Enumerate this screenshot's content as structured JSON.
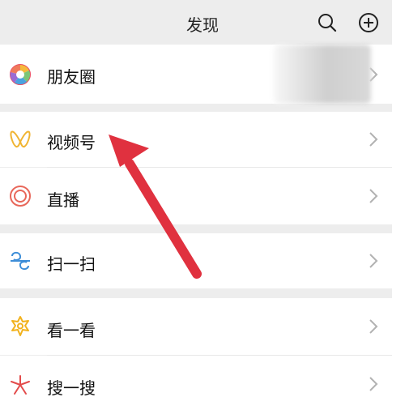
{
  "header": {
    "title": "发现"
  },
  "menu": {
    "moments": "朋友圈",
    "channels": "视频号",
    "live": "直播",
    "scan": "扫一扫",
    "top_stories": "看一看",
    "search": "搜一搜"
  },
  "colors": {
    "background": "#ededed",
    "row_background": "#ffffff",
    "arrow": "#e0313f"
  },
  "icons": [
    "moments-icon",
    "channels-icon",
    "live-icon",
    "scan-icon",
    "top-stories-icon",
    "search-feature-icon",
    "search-icon",
    "add-icon",
    "chevron-right-icon"
  ]
}
